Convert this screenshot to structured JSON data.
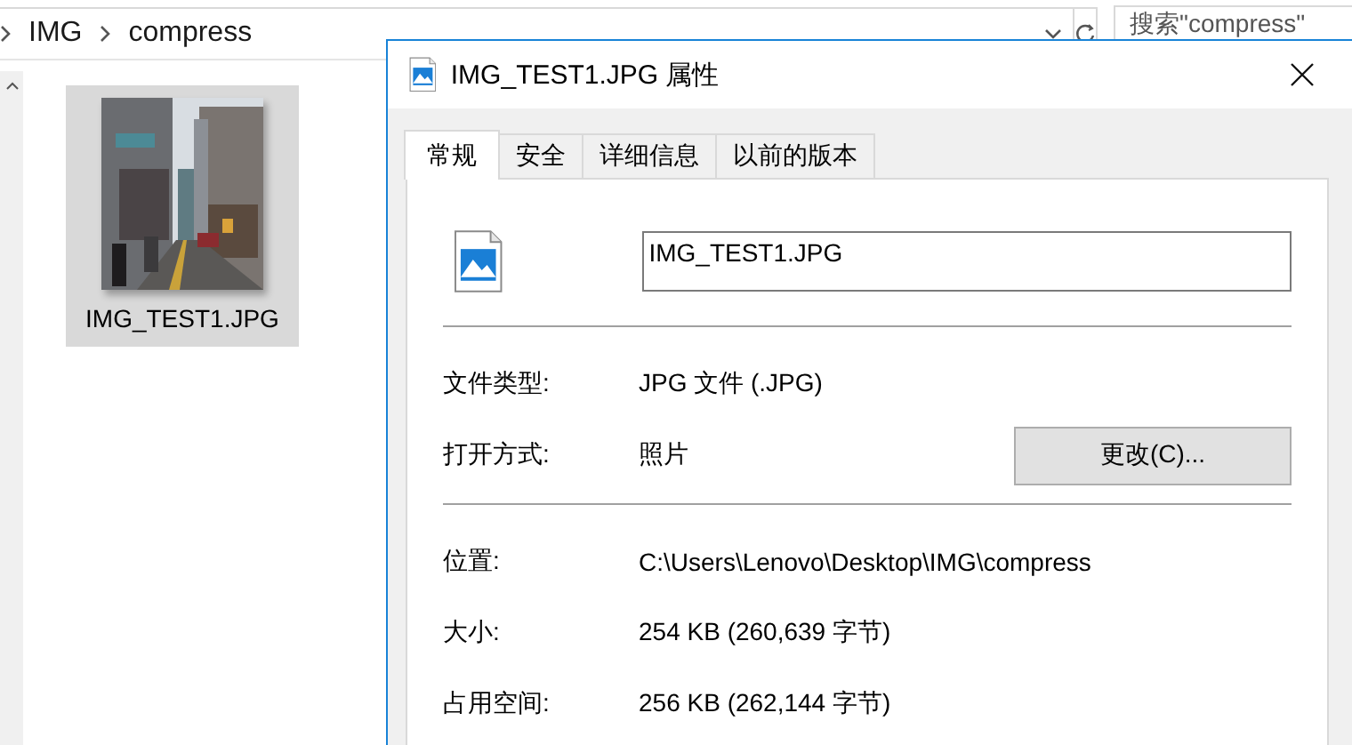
{
  "address_bar": {
    "path": [
      "IMG",
      "compress"
    ],
    "search": {
      "placeholder": "搜索\"compress\""
    }
  },
  "files": [
    {
      "name": "IMG_TEST1.JPG",
      "selected": true
    }
  ],
  "dialog": {
    "title": "IMG_TEST1.JPG 属性",
    "tabs": [
      {
        "label": "常规",
        "selected": true
      },
      {
        "label": "安全",
        "selected": false
      },
      {
        "label": "详细信息",
        "selected": false
      },
      {
        "label": "以前的版本",
        "selected": false
      }
    ],
    "file_name": "IMG_TEST1.JPG",
    "sections": [
      [
        {
          "label": "文件类型:",
          "value": "JPG 文件 (.JPG)"
        },
        {
          "label": "打开方式:",
          "value": "照片",
          "button": "更改(C)..."
        }
      ],
      [
        {
          "label": "位置:",
          "value": "C:\\Users\\Lenovo\\Desktop\\IMG\\compress"
        },
        {
          "label": "大小:",
          "value": "254 KB (260,639 字节)"
        },
        {
          "label": "占用空间:",
          "value": "256 KB (262,144 字节)"
        }
      ]
    ]
  }
}
